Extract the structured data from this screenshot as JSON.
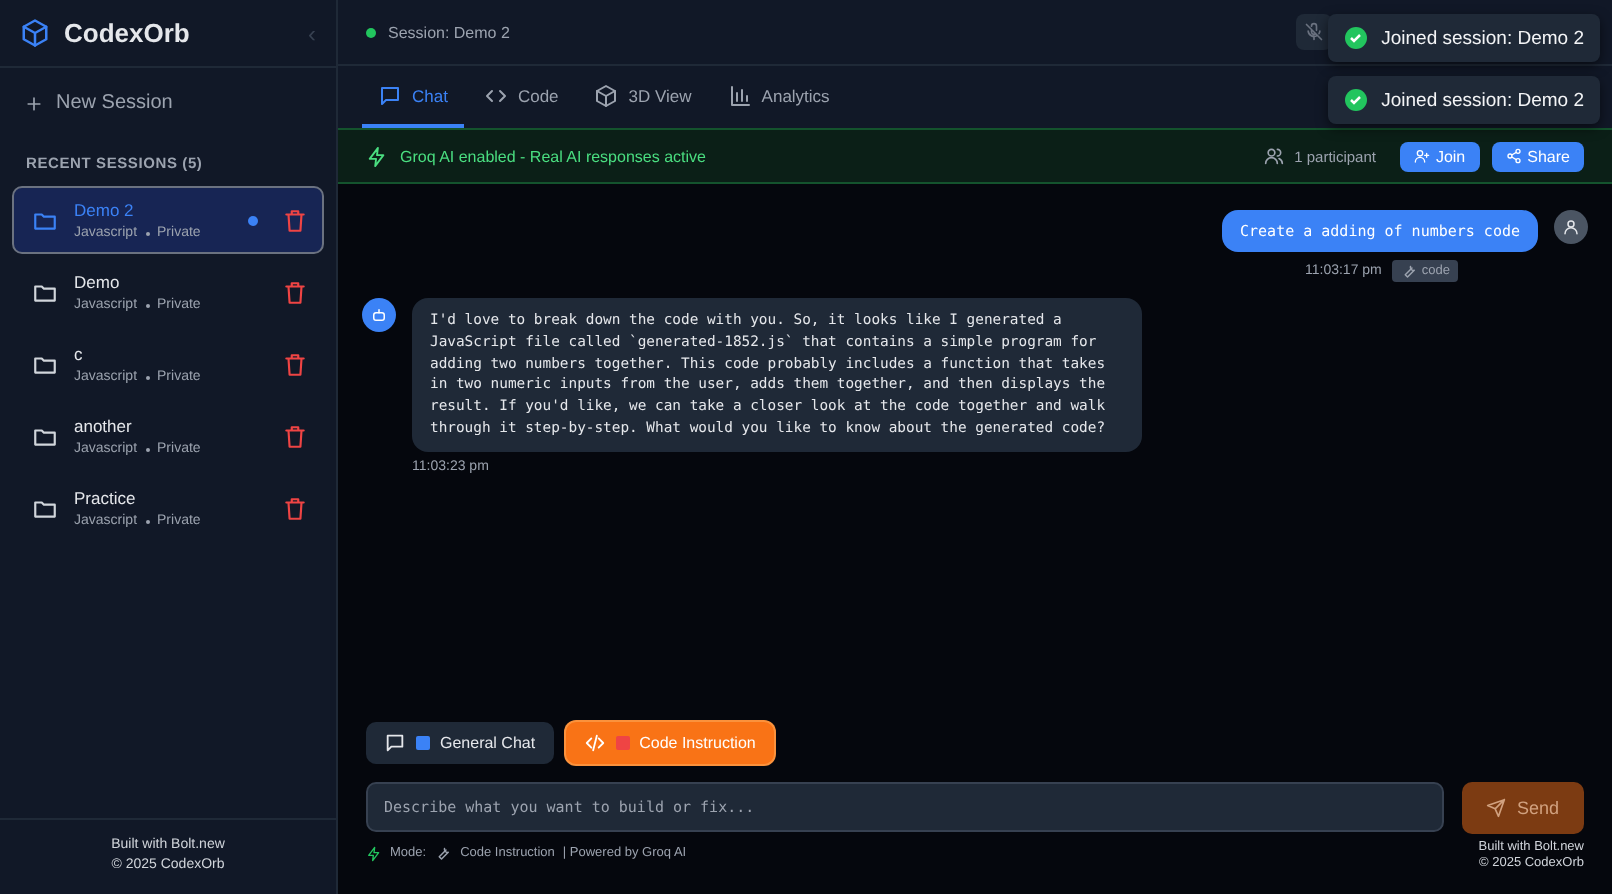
{
  "sidebar": {
    "logo": "CodexOrb",
    "collapse_icon": "‹",
    "new_session": "New Session",
    "section_title": "RECENT SESSIONS (5)",
    "sessions": [
      {
        "name": "Demo 2",
        "language": "Javascript",
        "visibility": "Private",
        "selected": true,
        "active": true
      },
      {
        "name": "Demo",
        "language": "Javascript",
        "visibility": "Private",
        "selected": false,
        "active": false
      },
      {
        "name": "c",
        "language": "Javascript",
        "visibility": "Private",
        "selected": false,
        "active": false
      },
      {
        "name": "another",
        "language": "Javascript",
        "visibility": "Private",
        "selected": false,
        "active": false
      },
      {
        "name": "Practice",
        "language": "Javascript",
        "visibility": "Private",
        "selected": false,
        "active": false
      }
    ],
    "footer": [
      "Built with Bolt.new",
      "© 2025 CodexOrb"
    ]
  },
  "header": {
    "session": "Session: Demo 2",
    "connected": true
  },
  "toasts": [
    "Joined session: Demo 2",
    "Joined session: Demo 2"
  ],
  "tabs": [
    {
      "label": "Chat",
      "selected": true
    },
    {
      "label": "Code",
      "selected": false
    },
    {
      "label": "3D View",
      "selected": false
    },
    {
      "label": "Analytics",
      "selected": false
    }
  ],
  "banner": {
    "text": "Groq AI enabled - Real AI responses active",
    "participants": "1 participant",
    "join": "Join",
    "share": "Share"
  },
  "messages": [
    {
      "kind": "user",
      "text": "Create a adding of numbers code",
      "time": "11:03:17 pm",
      "tag": "code"
    },
    {
      "kind": "assistant",
      "text": "I'd love to break down the code with you. So, it looks like I generated a JavaScript file called `generated-1852.js` that contains a simple program for adding two numbers together. This code probably includes a function that takes in two numeric inputs from the user, adds them together, and then displays the result. If you'd like, we can take a closer look at the code together and walk through it step-by-step. What would you like to know about the generated code?",
      "time": "11:03:23 pm"
    }
  ],
  "modes": [
    {
      "label": "General Chat",
      "selected": false,
      "color": "#3b82f6"
    },
    {
      "label": "Code Instruction",
      "selected": true,
      "color": "#ef4444"
    }
  ],
  "composer": {
    "placeholder": "Describe what you want to build or fix...",
    "send": "Send",
    "send_disabled": true
  },
  "mode_line": {
    "label": "Mode:",
    "mode": "Code Instruction",
    "powered": "| Powered by Groq AI"
  },
  "footer": [
    "Built with Bolt.new",
    "© 2025 CodexOrb"
  ]
}
